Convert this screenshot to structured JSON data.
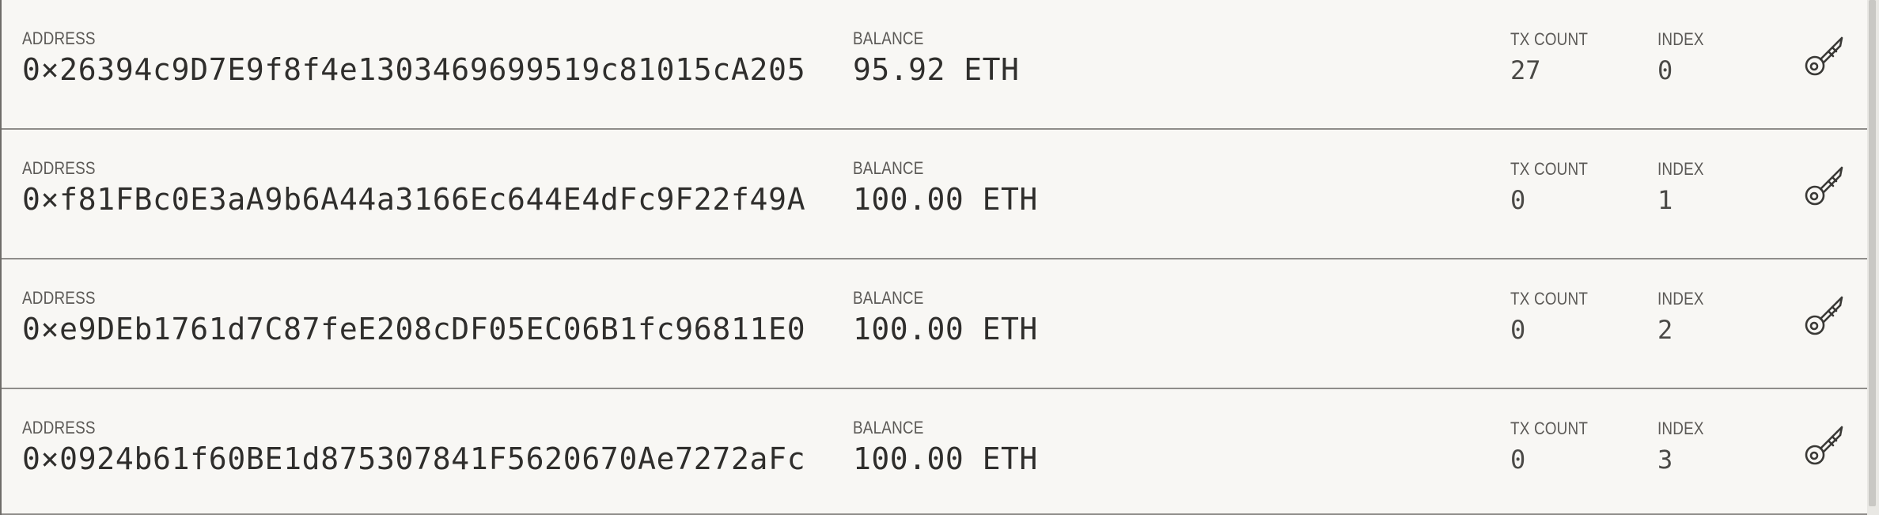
{
  "accounts": [
    {
      "address_label": "ADDRESS",
      "address": "0×26394c9D7E9f8f4e1303469699519c81015cA205",
      "balance_label": "BALANCE",
      "balance": "95.92 ETH",
      "tx_count_label": "TX COUNT",
      "tx_count": "27",
      "index_label": "INDEX",
      "index": "0",
      "key_icon": "key-icon"
    },
    {
      "address_label": "ADDRESS",
      "address": "0×f81FBc0E3aA9b6A44a3166Ec644E4dFc9F22f49A",
      "balance_label": "BALANCE",
      "balance": "100.00 ETH",
      "tx_count_label": "TX COUNT",
      "tx_count": "0",
      "index_label": "INDEX",
      "index": "1",
      "key_icon": "key-icon"
    },
    {
      "address_label": "ADDRESS",
      "address": "0×e9DEb1761d7C87feE208cDF05EC06B1fc96811E0",
      "balance_label": "BALANCE",
      "balance": "100.00 ETH",
      "tx_count_label": "TX COUNT",
      "tx_count": "0",
      "index_label": "INDEX",
      "index": "2",
      "key_icon": "key-icon"
    },
    {
      "address_label": "ADDRESS",
      "address": "0×0924b61f60BE1d875307841F5620670Ae7272aFc",
      "balance_label": "BALANCE",
      "balance": "100.00 ETH",
      "tx_count_label": "TX COUNT",
      "tx_count": "0",
      "index_label": "INDEX",
      "index": "3",
      "key_icon": "key-icon"
    }
  ],
  "colors": {
    "background": "#f8f7f4",
    "text": "#2f2e2c",
    "label": "#5c5a57",
    "divider": "#8f8d8a"
  }
}
